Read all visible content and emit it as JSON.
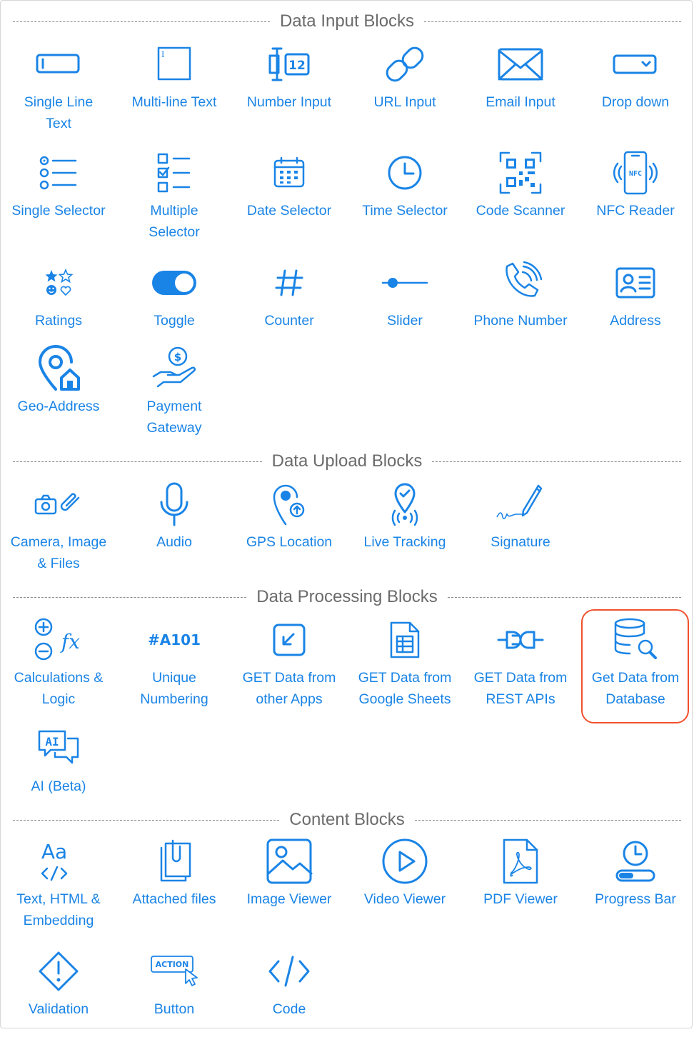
{
  "sections": {
    "input": {
      "title": "Data Input Blocks",
      "items": [
        {
          "label": "Single Line\nText",
          "icon": "single-line-text-icon"
        },
        {
          "label": "Multi-line Text",
          "icon": "multi-line-text-icon"
        },
        {
          "label": "Number Input",
          "icon": "number-input-icon"
        },
        {
          "label": "URL Input",
          "icon": "link-icon"
        },
        {
          "label": "Email Input",
          "icon": "envelope-icon"
        },
        {
          "label": "Drop down",
          "icon": "dropdown-icon"
        },
        {
          "label": "Single Selector",
          "icon": "radio-list-icon"
        },
        {
          "label": "Multiple\nSelector",
          "icon": "checkbox-list-icon"
        },
        {
          "label": "Date Selector",
          "icon": "calendar-icon"
        },
        {
          "label": "Time Selector",
          "icon": "clock-icon"
        },
        {
          "label": "Code Scanner",
          "icon": "qr-code-icon"
        },
        {
          "label": "NFC Reader",
          "icon": "nfc-phone-icon"
        },
        {
          "label": "Ratings",
          "icon": "ratings-icon"
        },
        {
          "label": "Toggle",
          "icon": "toggle-icon"
        },
        {
          "label": "Counter",
          "icon": "hash-icon"
        },
        {
          "label": "Slider",
          "icon": "slider-icon"
        },
        {
          "label": "Phone Number",
          "icon": "phone-icon"
        },
        {
          "label": "Address",
          "icon": "address-card-icon"
        },
        {
          "label": "Geo-Address",
          "icon": "geo-address-icon"
        },
        {
          "label": "Payment\nGateway",
          "icon": "payment-hand-icon"
        }
      ]
    },
    "upload": {
      "title": "Data Upload Blocks",
      "items": [
        {
          "label": "Camera, Image\n& Files",
          "icon": "camera-paperclip-icon"
        },
        {
          "label": "Audio",
          "icon": "microphone-icon"
        },
        {
          "label": "GPS Location",
          "icon": "gps-pin-icon"
        },
        {
          "label": "Live Tracking",
          "icon": "live-tracking-icon"
        },
        {
          "label": "Signature",
          "icon": "signature-pen-icon"
        }
      ]
    },
    "processing": {
      "title": "Data Processing Blocks",
      "items": [
        {
          "label": "Calculations &\nLogic",
          "icon": "calculations-fx-icon"
        },
        {
          "label": "Unique\nNumbering",
          "icon": "unique-number-icon",
          "icon_text": "#A101"
        },
        {
          "label": "GET Data from\nother Apps",
          "icon": "import-arrow-icon"
        },
        {
          "label": "GET Data from\nGoogle Sheets",
          "icon": "sheets-document-icon"
        },
        {
          "label": "GET Data from\nREST APIs",
          "icon": "plug-icon"
        },
        {
          "label": "Get Data from\nDatabase",
          "icon": "database-search-icon"
        },
        {
          "label": "AI (Beta)",
          "icon": "ai-chat-icon",
          "icon_text": "AI"
        }
      ]
    },
    "content": {
      "title": "Content Blocks",
      "items": [
        {
          "label": "Text, HTML &\nEmbedding",
          "icon": "text-code-icon",
          "icon_text": "Aa"
        },
        {
          "label": "Attached files",
          "icon": "attachment-files-icon"
        },
        {
          "label": "Image Viewer",
          "icon": "image-icon"
        },
        {
          "label": "Video Viewer",
          "icon": "play-icon"
        },
        {
          "label": "PDF Viewer",
          "icon": "pdf-file-icon"
        },
        {
          "label": "Progress Bar",
          "icon": "progress-clock-icon"
        },
        {
          "label": "Validation",
          "icon": "warning-diamond-icon"
        },
        {
          "label": "Button",
          "icon": "action-button-icon",
          "icon_text": "ACTION"
        },
        {
          "label": "Code",
          "icon": "code-brackets-icon"
        }
      ]
    }
  },
  "colors": {
    "accent": "#1a84e6",
    "header_text": "#6b6b6b",
    "highlight": "#f0502c"
  }
}
